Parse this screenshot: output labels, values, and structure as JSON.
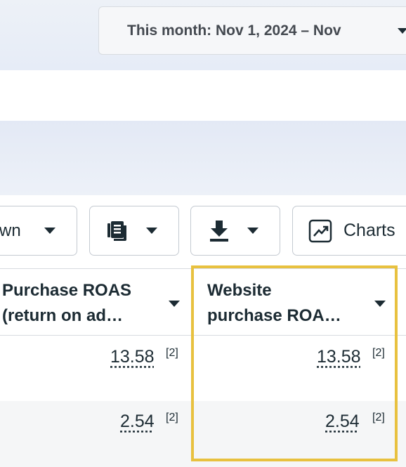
{
  "date_range": {
    "label": "This month: Nov 1, 2024 – Nov"
  },
  "toolbar": {
    "breakdown_label": "wn",
    "charts_label": "Charts"
  },
  "table": {
    "columns": [
      {
        "line1": "Purchase ROAS",
        "line2": "(return on ad…"
      },
      {
        "line1": "Website",
        "line2": "purchase ROA…"
      }
    ],
    "rows": [
      {
        "purchase_roas": "13.58",
        "purchase_roas_fn": "[2]",
        "website_roas": "13.58",
        "website_roas_fn": "[2]"
      },
      {
        "purchase_roas": "2.54",
        "purchase_roas_fn": "[2]",
        "website_roas": "2.54",
        "website_roas_fn": "[2]"
      }
    ]
  },
  "colors": {
    "highlight": "#e8c13f",
    "text": "#1c2b33"
  },
  "icons": [
    "chevron-down-icon",
    "report-icon",
    "download-icon",
    "chart-icon"
  ]
}
